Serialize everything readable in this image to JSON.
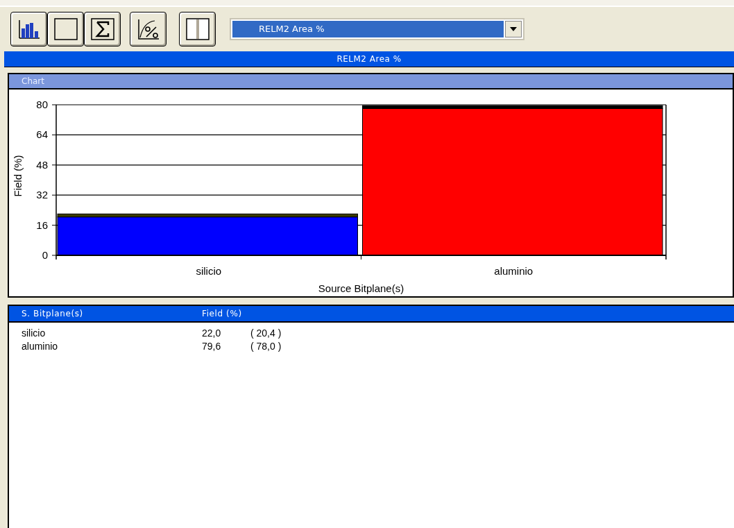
{
  "dropdown": {
    "value": "RELM2 Area %"
  },
  "title_bar": "RELM2 Area %",
  "chart_panel": {
    "title": "Chart",
    "chart_data": {
      "type": "bar",
      "stacked": true,
      "grid": true,
      "xlabel": "Source Bitplane(s)",
      "ylabel": "Field (%)",
      "categories": [
        "silicio",
        "aluminio"
      ],
      "ylim": [
        0,
        80
      ],
      "yticks": [
        0,
        16,
        32,
        48,
        64,
        80
      ],
      "series": [
        {
          "colors": [
            "#0000ff",
            "#ff0000"
          ],
          "values": [
            20.4,
            78.0
          ]
        },
        {
          "colors": [
            "#3c3c00",
            "#000000"
          ],
          "values": [
            1.6,
            1.6
          ]
        }
      ]
    }
  },
  "table": {
    "columns": [
      "S. Bitplane(s)",
      "Field (%)"
    ],
    "rows": [
      [
        "silicio",
        "22,0",
        "( 20,4 )"
      ],
      [
        "aluminio",
        "79,6",
        "( 78,0 )"
      ]
    ]
  }
}
